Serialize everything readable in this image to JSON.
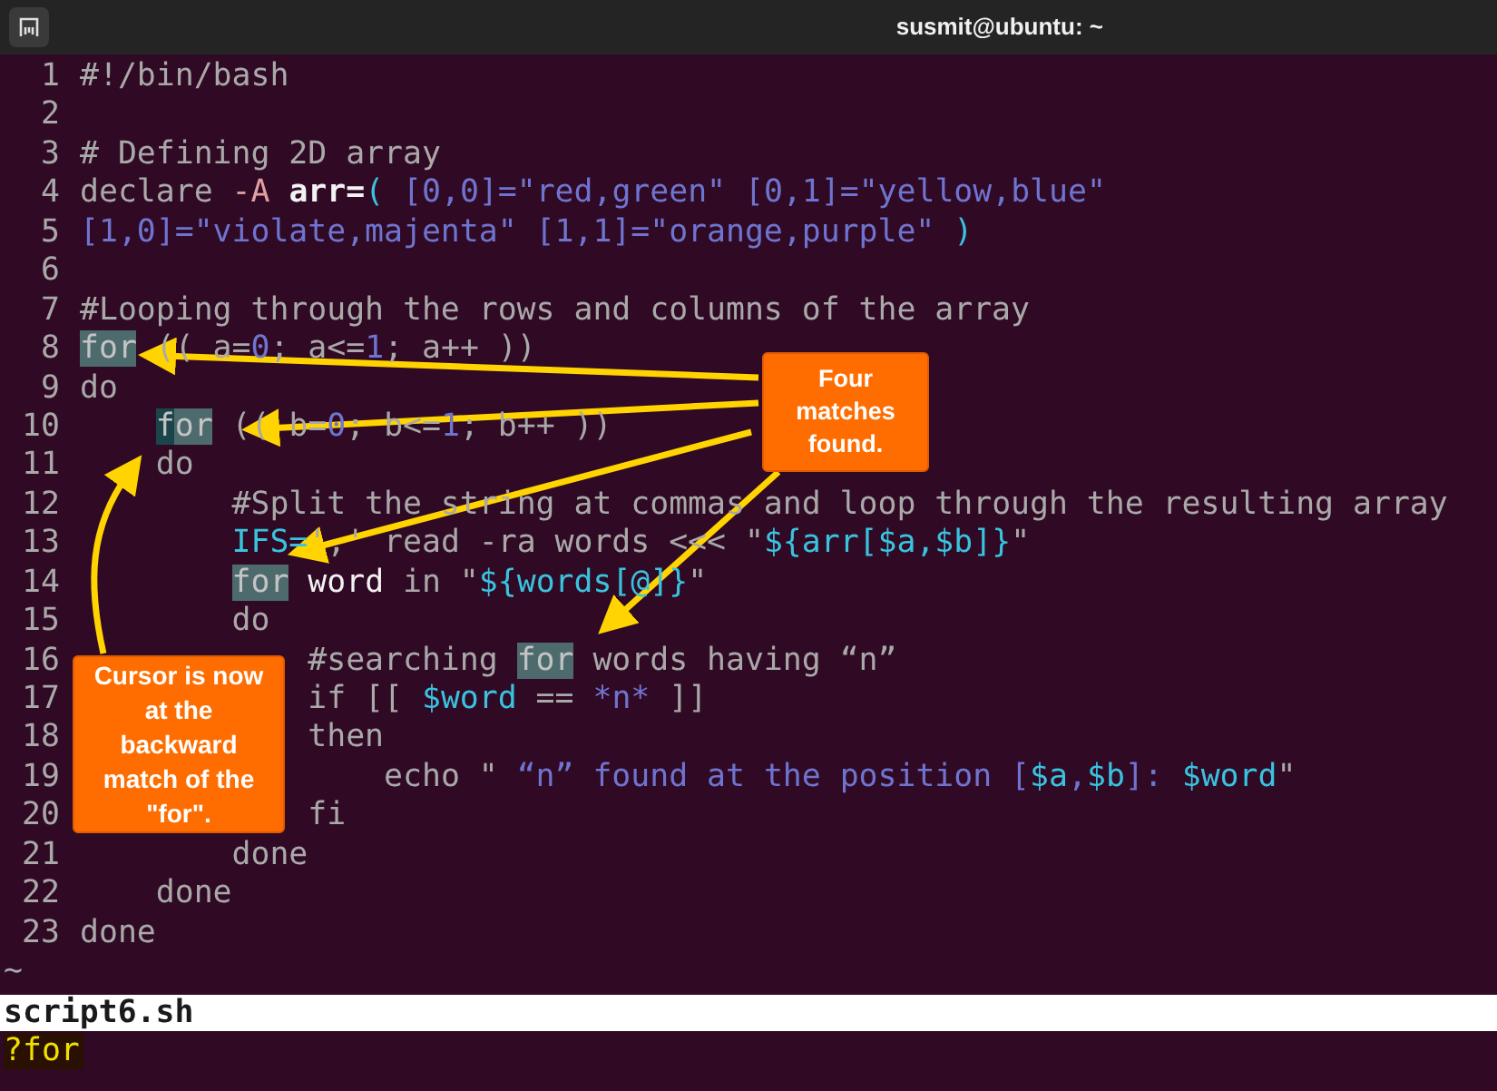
{
  "window": {
    "title": "susmit@ubuntu: ~"
  },
  "editor": {
    "lines": [
      {
        "number": "1",
        "tokens": [
          {
            "t": "#!/bin/bash",
            "kind": "comment"
          }
        ]
      },
      {
        "number": "2"
      },
      {
        "number": "3",
        "tokens": [
          {
            "t": "# Defining 2D array",
            "kind": "comment"
          }
        ]
      },
      {
        "number": "4",
        "tokens": [
          {
            "t": "declare ",
            "kind": "plain"
          },
          {
            "t": "-A ",
            "kind": "option"
          },
          {
            "t": "arr=",
            "kind": "bold"
          },
          {
            "t": "(",
            "kind": "var"
          },
          {
            "t": " [0,0]=\"red,green\" [0,1]=\"yellow,blue\"",
            "kind": "string"
          }
        ]
      },
      {
        "number": "5",
        "tokens": [
          {
            "t": "[1,0]=\"violate,majenta\" [1,1]=\"orange,purple\" ",
            "kind": "string"
          },
          {
            "t": ")",
            "kind": "var"
          }
        ]
      },
      {
        "number": "6"
      },
      {
        "number": "7",
        "tokens": [
          {
            "t": "#Looping through the rows and columns of the array",
            "kind": "comment"
          }
        ]
      },
      {
        "number": "8",
        "tokens": [
          {
            "t": "for",
            "kind": "match"
          },
          {
            "t": " (( a=",
            "kind": "plain"
          },
          {
            "t": "0",
            "kind": "string"
          },
          {
            "t": "; a<=",
            "kind": "plain"
          },
          {
            "t": "1",
            "kind": "string"
          },
          {
            "t": "; a++ ))",
            "kind": "plain"
          }
        ]
      },
      {
        "number": "9",
        "tokens": [
          {
            "t": "do",
            "kind": "plain"
          }
        ]
      },
      {
        "number": "10",
        "tokens": [
          {
            "t": "    for",
            "kind": "cursor_match"
          },
          {
            "t": " (( b=",
            "kind": "plain"
          },
          {
            "t": "0",
            "kind": "string"
          },
          {
            "t": "; b<=",
            "kind": "plain"
          },
          {
            "t": "1",
            "kind": "string"
          },
          {
            "t": "; b++ ))",
            "kind": "plain"
          }
        ]
      },
      {
        "number": "11",
        "tokens": [
          {
            "t": "    do",
            "kind": "plain"
          }
        ]
      },
      {
        "number": "12",
        "tokens": [
          {
            "t": "        #Split the string at commas and loop through the resulting array",
            "kind": "comment"
          }
        ]
      },
      {
        "number": "13",
        "tokens": [
          {
            "t": "        IFS=",
            "kind": "var"
          },
          {
            "t": "',' read -ra words <<< \"",
            "kind": "plain"
          },
          {
            "t": "${arr[$a,$b]}",
            "kind": "var"
          },
          {
            "t": "\"",
            "kind": "plain"
          }
        ]
      },
      {
        "number": "14",
        "tokens": [
          {
            "t": "        for",
            "kind": "match"
          },
          {
            "t": " word",
            "kind": "bright"
          },
          {
            "t": " in \"",
            "kind": "plain"
          },
          {
            "t": "${words[@]}",
            "kind": "var"
          },
          {
            "t": "\"",
            "kind": "plain"
          }
        ]
      },
      {
        "number": "15",
        "tokens": [
          {
            "t": "        do",
            "kind": "plain"
          }
        ]
      },
      {
        "number": "16",
        "tokens": [
          {
            "t": "            #searching ",
            "kind": "comment"
          },
          {
            "t": "for",
            "kind": "match"
          },
          {
            "t": " words having “n”",
            "kind": "comment"
          }
        ]
      },
      {
        "number": "17",
        "tokens": [
          {
            "t": "            if [[ ",
            "kind": "plain"
          },
          {
            "t": "$word",
            "kind": "var"
          },
          {
            "t": " == ",
            "kind": "plain"
          },
          {
            "t": "*n*",
            "kind": "string"
          },
          {
            "t": " ]]",
            "kind": "plain"
          }
        ]
      },
      {
        "number": "18",
        "tokens": [
          {
            "t": "            then",
            "kind": "plain"
          }
        ]
      },
      {
        "number": "19",
        "tokens": [
          {
            "t": "                echo \" ",
            "kind": "plain"
          },
          {
            "t": "“n” found at the position [",
            "kind": "string"
          },
          {
            "t": "$a",
            "kind": "var"
          },
          {
            "t": ",",
            "kind": "string"
          },
          {
            "t": "$b",
            "kind": "var"
          },
          {
            "t": "]: ",
            "kind": "string"
          },
          {
            "t": "$word",
            "kind": "var"
          },
          {
            "t": "\"",
            "kind": "plain"
          }
        ]
      },
      {
        "number": "20",
        "tokens": [
          {
            "t": "            fi",
            "kind": "plain"
          }
        ]
      },
      {
        "number": "21",
        "tokens": [
          {
            "t": "        done",
            "kind": "plain"
          }
        ]
      },
      {
        "number": "22",
        "tokens": [
          {
            "t": "    done",
            "kind": "plain"
          }
        ]
      },
      {
        "number": "23",
        "tokens": [
          {
            "t": "done",
            "kind": "plain"
          }
        ]
      }
    ],
    "filler": "~"
  },
  "status_line": "script6.sh",
  "command_line": "?for",
  "callouts": [
    {
      "text": "Four matches found."
    },
    {
      "text": "Cursor is now at the backward match of the \"for\"."
    }
  ]
}
